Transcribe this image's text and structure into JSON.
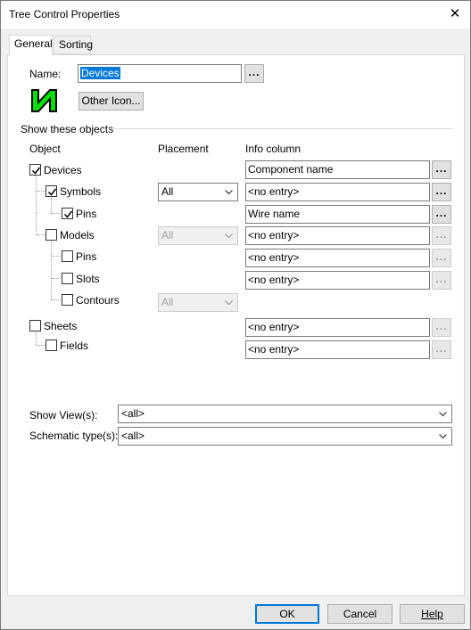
{
  "window": {
    "title": "Tree Control Properties",
    "close_glyph": "✕"
  },
  "tabs": [
    {
      "label": "General",
      "active": true
    },
    {
      "label": "Sorting",
      "active": false
    }
  ],
  "name_field": {
    "label": "Name:",
    "value": "Devices",
    "browse_label": "..."
  },
  "icon": {
    "name": "green-lightning-icon",
    "color": "#00e000",
    "button_label": "Other Icon..."
  },
  "group": {
    "title": "Show these objects",
    "headers": {
      "object": "Object",
      "placement": "Placement",
      "info": "Info column"
    }
  },
  "objects": {
    "devices": {
      "label": "Devices",
      "checked": true,
      "info": "Component name",
      "info_browse": "..."
    },
    "symbols": {
      "label": "Symbols",
      "checked": true,
      "placement": "All",
      "info": "<no entry>",
      "info_browse": "..."
    },
    "symbol_pins": {
      "label": "Pins",
      "checked": true,
      "info": "Wire name",
      "info_browse": "..."
    },
    "models": {
      "label": "Models",
      "checked": false,
      "placement": "All",
      "info": "<no entry>",
      "info_browse": "..."
    },
    "model_pins": {
      "label": "Pins",
      "checked": false,
      "info": "<no entry>",
      "info_browse": "..."
    },
    "slots": {
      "label": "Slots",
      "checked": false,
      "info": "<no entry>",
      "info_browse": "..."
    },
    "contours": {
      "label": "Contours",
      "checked": false,
      "placement": "All"
    },
    "sheets": {
      "label": "Sheets",
      "checked": false,
      "info": "<no entry>",
      "info_browse": "..."
    },
    "fields": {
      "label": "Fields",
      "checked": false,
      "info": "<no entry>",
      "info_browse": "..."
    }
  },
  "filters": {
    "views": {
      "label": "Show View(s):",
      "value": "<all>"
    },
    "schematic": {
      "label": "Schematic type(s):",
      "value": "<all>"
    }
  },
  "footer": {
    "ok": "OK",
    "cancel": "Cancel",
    "help": "Help"
  },
  "colors": {
    "selection": "#0078d7",
    "check": "#000000",
    "disabled_text": "#a0a0a0"
  }
}
